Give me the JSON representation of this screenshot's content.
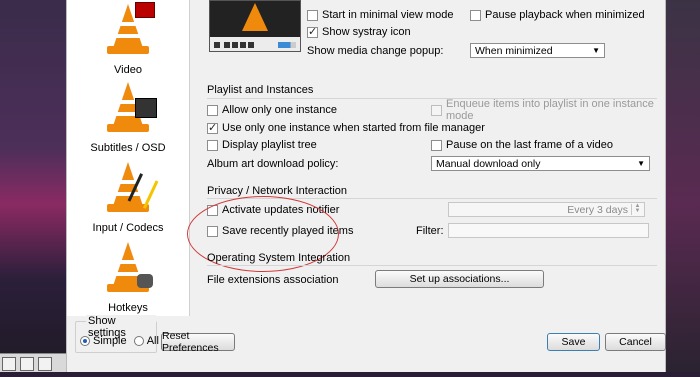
{
  "sidebar": {
    "items": [
      {
        "label": "Video",
        "icon": "vlc-cone-video-icon"
      },
      {
        "label": "Subtitles / OSD",
        "icon": "vlc-cone-subtitles-icon"
      },
      {
        "label": "Input / Codecs",
        "icon": "vlc-cone-codecs-icon"
      },
      {
        "label": "Hotkeys",
        "icon": "vlc-cone-hotkeys-icon"
      }
    ]
  },
  "interface": {
    "minimal_view": "Start in minimal view mode",
    "systray": "Show systray icon",
    "pause_minimized": "Pause playback when minimized",
    "media_popup_label": "Show media change popup:",
    "media_popup_value": "When minimized"
  },
  "playlist": {
    "title": "Playlist and Instances",
    "allow_one_instance": "Allow only one instance",
    "enqueue": "Enqueue items into playlist in one instance mode",
    "one_instance_fm": "Use only one instance when started from file manager",
    "display_tree": "Display playlist tree",
    "pause_last_frame": "Pause on the last frame of a video",
    "album_art_label": "Album art download policy:",
    "album_art_value": "Manual download only"
  },
  "privacy": {
    "title": "Privacy / Network Interaction",
    "updates_notifier": "Activate updates notifier",
    "updates_interval": "Every 3 days",
    "save_recent": "Save recently played items",
    "filter_label": "Filter:"
  },
  "os": {
    "title": "Operating System Integration",
    "file_ext_label": "File extensions association",
    "setup_button": "Set up associations..."
  },
  "footer": {
    "show_settings": "Show settings",
    "simple": "Simple",
    "all": "All",
    "reset": "Reset Preferences",
    "save": "Save",
    "cancel": "Cancel"
  },
  "colors": {
    "cone": "#f08a0c",
    "annotation": "#d23a3a"
  }
}
